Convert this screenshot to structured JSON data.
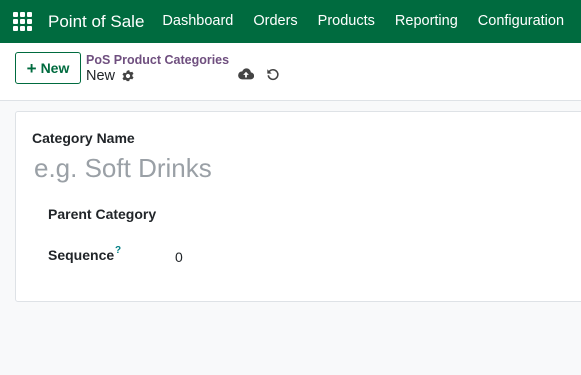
{
  "navbar": {
    "brand": "Point of Sale",
    "menu": [
      {
        "label": "Dashboard"
      },
      {
        "label": "Orders"
      },
      {
        "label": "Products"
      },
      {
        "label": "Reporting"
      },
      {
        "label": "Configuration"
      }
    ],
    "color": "#006b3f"
  },
  "control_panel": {
    "new_button": "New",
    "breadcrumb": "PoS Product Categories",
    "record_name": "New",
    "icons": [
      "gear-icon",
      "cloud-upload-icon",
      "undo-icon"
    ]
  },
  "form": {
    "category_name_label": "Category Name",
    "category_name_value": "",
    "category_name_placeholder": "e.g. Soft Drinks",
    "parent_label": "Parent Category",
    "parent_value": "",
    "sequence_label": "Sequence",
    "sequence_help": "?",
    "sequence_value": "0"
  }
}
